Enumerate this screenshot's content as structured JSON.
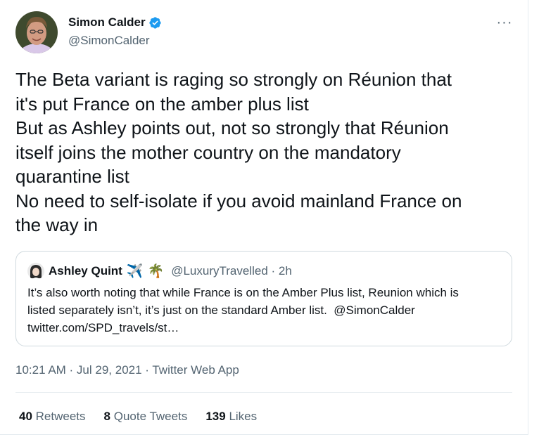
{
  "tweet": {
    "display_name": "Simon Calder",
    "handle": "@SimonCalder",
    "more_label": "···",
    "text": "The Beta variant is raging so strongly on Réunion that\nit's put France on the amber plus list\nBut as Ashley points out, not so strongly that Réunion\nitself joins the mother country on the mandatory\nquarantine list\nNo need to self-isolate if you avoid mainland France on\nthe way in",
    "timestamp": "10:21 AM · Jul 29, 2021 · Twitter Web App",
    "colors": {
      "verified": "#1d9bf0",
      "secondary_text": "#536471",
      "border": "#cfd9de"
    }
  },
  "quote": {
    "display_name": "Ashley Quint",
    "emoji_1": "✈️",
    "emoji_2": "🌴",
    "handle_time": "@LuxuryTravelled · 2h",
    "text": "It’s also worth noting that while France is on the Amber Plus list, Reunion which is\nlisted separately isn’t, it’s just on the standard Amber list.  @SimonCalder\ntwitter.com/SPD_travels/st…"
  },
  "stats": {
    "retweets_count": "40",
    "retweets_label": "Retweets",
    "quotes_count": "8",
    "quotes_label": "Quote Tweets",
    "likes_count": "139",
    "likes_label": "Likes"
  },
  "icons": {
    "avatar": "user-avatar",
    "verified": "verified-badge-icon",
    "more": "more-options-icon",
    "quote_avatar": "quote-user-avatar"
  }
}
